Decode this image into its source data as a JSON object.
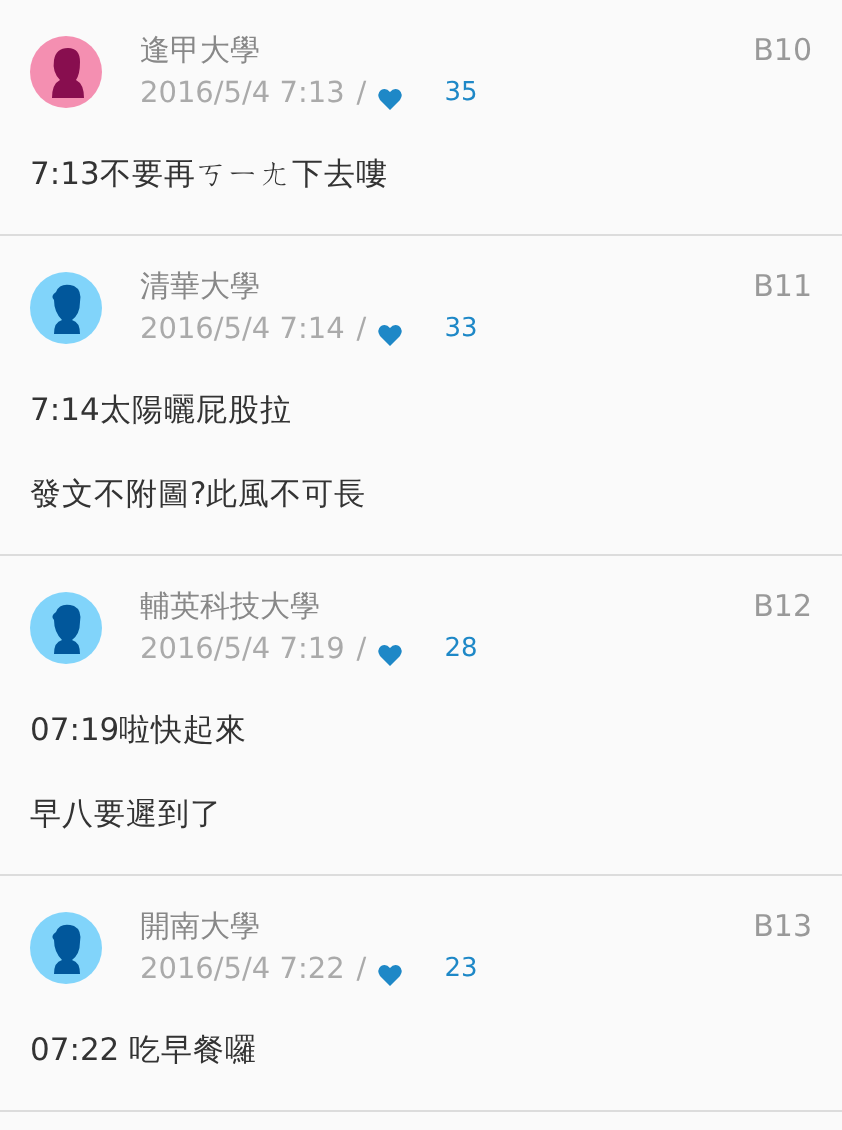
{
  "comments": [
    {
      "school": "逢甲大學",
      "avatar": {
        "kind": "female"
      },
      "time": "2016/5/4 7:13",
      "separator": "/",
      "likes": "35",
      "floor": "B10",
      "paragraphs": [
        "7:13不要再ㄎㄧㄤ下去嘍"
      ]
    },
    {
      "school": "清華大學",
      "avatar": {
        "kind": "male"
      },
      "time": "2016/5/4 7:14",
      "separator": "/",
      "likes": "33",
      "floor": "B11",
      "paragraphs": [
        "7:14太陽曬屁股拉",
        "發文不附圖?此風不可長"
      ]
    },
    {
      "school": "輔英科技大學",
      "avatar": {
        "kind": "male"
      },
      "time": "2016/5/4 7:19",
      "separator": "/",
      "likes": "28",
      "floor": "B12",
      "paragraphs": [
        "07:19啦快起來",
        "早八要遲到了"
      ]
    },
    {
      "school": "開南大學",
      "avatar": {
        "kind": "male"
      },
      "time": "2016/5/4 7:22",
      "separator": "/",
      "likes": "23",
      "floor": "B13",
      "paragraphs": [
        "07:22 吃早餐囉"
      ]
    }
  ]
}
